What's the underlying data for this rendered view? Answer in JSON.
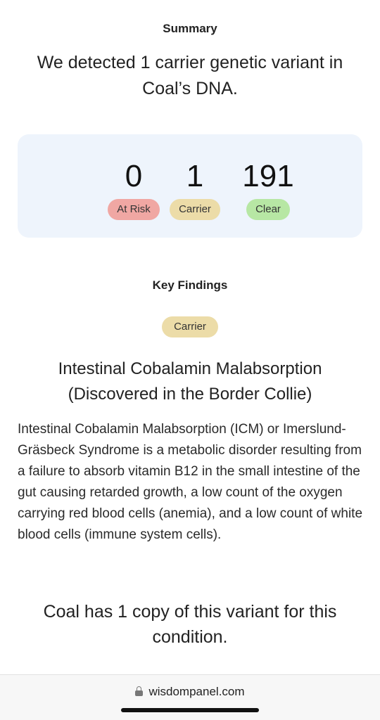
{
  "summary": {
    "heading": "Summary",
    "headline": "We detected 1 carrier genetic variant in Coal’s DNA."
  },
  "stats": {
    "at_risk": {
      "count": "0",
      "label": "At Risk",
      "color": "#f0a7a3"
    },
    "carrier": {
      "count": "1",
      "label": "Carrier",
      "color": "#ecdca8"
    },
    "clear": {
      "count": "191",
      "label": "Clear",
      "color": "#b7e7a4"
    }
  },
  "key_findings": {
    "heading": "Key Findings",
    "badge": "Carrier",
    "condition_title": "Intestinal Cobalamin Malabsorption (Discovered in the Border Collie)",
    "description": "Intestinal Cobalamin Malabsorption (ICM) or Imerslund-Gräsbeck Syndrome is a metabolic disorder resulting from a failure to absorb vitamin B12 in the small intestine of the gut causing retarded growth, a low count of the oxygen carrying red blood cells (anemia), and a low count of white blood cells (immune system cells).",
    "copy_statement": "Coal has 1 copy of this variant for this condition."
  },
  "browser": {
    "url": "wisdompanel.com",
    "icon": "lock-icon"
  }
}
